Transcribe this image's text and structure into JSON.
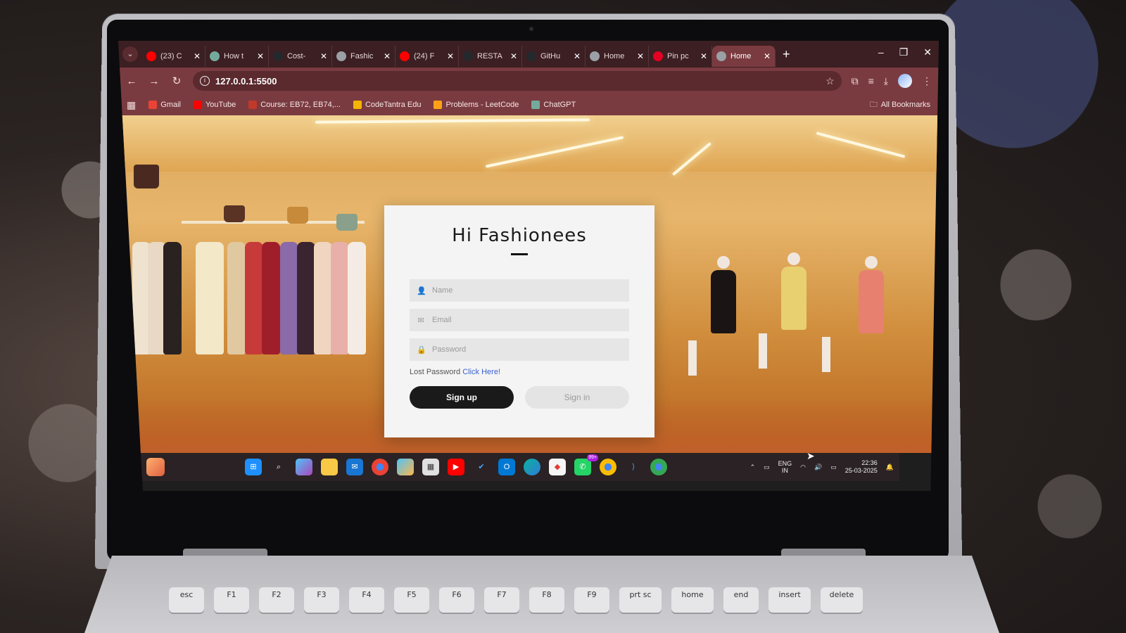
{
  "browser": {
    "tabs": [
      {
        "title": "(23) C",
        "icon_color": "#ff0000",
        "icon": "youtube-icon"
      },
      {
        "title": "How t",
        "icon_color": "#74aa9c",
        "icon": "chatgpt-icon"
      },
      {
        "title": "Cost-",
        "icon_color": "#24292e",
        "icon": "github-icon"
      },
      {
        "title": "Fashic",
        "icon_color": "#9aa0a6",
        "icon": "globe-icon"
      },
      {
        "title": "(24) F",
        "icon_color": "#ff0000",
        "icon": "youtube-icon"
      },
      {
        "title": "RESTA",
        "icon_color": "#24292e",
        "icon": "github-icon"
      },
      {
        "title": "GitHu",
        "icon_color": "#24292e",
        "icon": "github-icon"
      },
      {
        "title": "Home",
        "icon_color": "#9aa0a6",
        "icon": "globe-icon"
      },
      {
        "title": "Pin pc",
        "icon_color": "#e60023",
        "icon": "pinterest-icon"
      },
      {
        "title": "Home",
        "icon_color": "#9aa0a6",
        "icon": "globe-icon",
        "active": true
      }
    ],
    "url": "127.0.0.1:5500",
    "bookmarks": [
      {
        "label": "Gmail",
        "color": "#ea4335"
      },
      {
        "label": "YouTube",
        "color": "#ff0000"
      },
      {
        "label": "Course: EB72, EB74,...",
        "color": "#c0392b"
      },
      {
        "label": "CodeTantra Edu",
        "color": "#f4b400"
      },
      {
        "label": "Problems - LeetCode",
        "color": "#ffa116"
      },
      {
        "label": "ChatGPT",
        "color": "#74aa9c"
      }
    ],
    "all_bookmarks": "All Bookmarks",
    "accent": "#7a3b40"
  },
  "login": {
    "title": "Hi Fashionees",
    "name_placeholder": "Name",
    "email_placeholder": "Email",
    "password_placeholder": "Password",
    "lost_password": "Lost Password",
    "click_here": "Click Here!",
    "signup": "Sign up",
    "signin": "Sign in"
  },
  "taskbar": {
    "badge": "99+",
    "lang_top": "ENG",
    "lang_bottom": "IN",
    "time": "22:36",
    "date": "25-03-2025"
  },
  "keyboard": {
    "keys": [
      "esc",
      "F1",
      "F2",
      "F3",
      "F4",
      "F5",
      "F6",
      "F7",
      "F8",
      "F9",
      "prt sc",
      "home",
      "end",
      "insert",
      "delete"
    ]
  }
}
